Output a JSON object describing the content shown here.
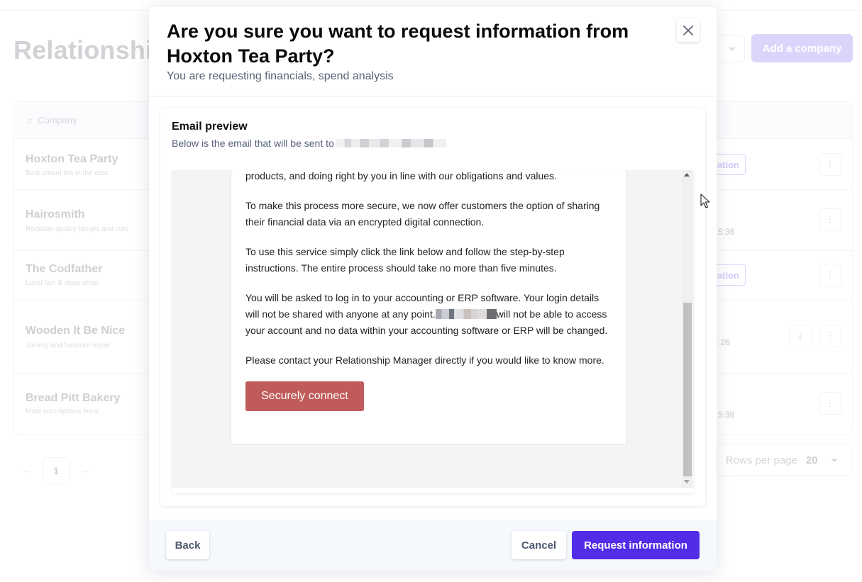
{
  "background": {
    "page_title": "Relationships",
    "add_company_label": "Add a company",
    "table": {
      "column_header": "Company",
      "rows": [
        {
          "name": "Hoxton Tea Party",
          "description": "Best cream tea in the east",
          "status_pill": "ation",
          "time": "",
          "has_download": false
        },
        {
          "name": "Hairosmith",
          "description": "Rockstar-quality fringes and cuts",
          "status_pill": "",
          "time": "5:36",
          "has_download": false
        },
        {
          "name": "The Codfather",
          "description": "Local fish & chips shop",
          "status_pill": "ation",
          "time": "",
          "has_download": false
        },
        {
          "name": "Wooden It Be Nice",
          "description": "Joinery and furniture repair",
          "status_pill": "",
          "time": ":26",
          "has_download": true
        },
        {
          "name": "Bread Pitt Bakery",
          "description": "Most scrumptious buns",
          "status_pill": "",
          "time": "5:38",
          "has_download": false
        }
      ]
    },
    "pagination": {
      "current_page": "1",
      "prev_icon": "arrow-left",
      "next_icon": "arrow-right",
      "rows_per_page_label": "Rows per page",
      "rows_per_page_value": "20"
    }
  },
  "modal": {
    "title": "Are you sure you want to request information from Hoxton Tea Party?",
    "subtitle": "You are requesting financials, spend analysis",
    "close_icon": "close-x",
    "preview": {
      "title": "Email preview",
      "subtitle": "Below is the email that will be sent to",
      "recipient_redacted": true,
      "email": {
        "paragraph_1": "products, and doing right by you in line with our obligations and values.",
        "paragraph_2": "To make this process more secure, we now offer customers the option of sharing their financial data via an encrypted digital connection.",
        "paragraph_3": "To use this service simply click the link below and follow the step-by-step instructions. The entire process should take no more than five minutes.",
        "paragraph_4_a": "You will be asked to log in to your accounting or ERP software. Your login details will not be shared with anyone at any point.",
        "paragraph_4_b": "will not be able to access your account and no data within your accounting software or ERP will be changed.",
        "paragraph_5": "Please contact your Relationship Manager directly if you would like to know more.",
        "cta_label": "Securely connect"
      },
      "scroll_position": 0.6
    },
    "footer": {
      "back_label": "Back",
      "cancel_label": "Cancel",
      "primary_label": "Request information"
    }
  },
  "colors": {
    "primary": "#522ce6",
    "cta": "#c05b5b",
    "footer_bg": "#f5f8fc"
  }
}
